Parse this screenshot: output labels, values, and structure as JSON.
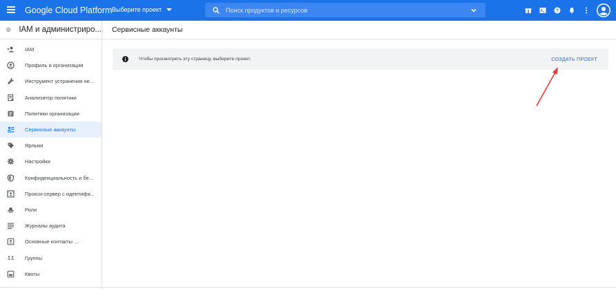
{
  "topbar": {
    "brand": "Google Cloud Platform",
    "project_select": "Выберите проект",
    "search_placeholder": "Поиск продуктов и ресурсов",
    "color": "#1a73e8",
    "icons": [
      "gift-icon",
      "terminal-icon",
      "help-icon",
      "bell-icon",
      "more-vert-icon",
      "account-icon"
    ]
  },
  "sidebar": {
    "title": "IAM и администриро...",
    "items": [
      {
        "label": "IAM",
        "icon": "person-add-icon",
        "active": false
      },
      {
        "label": "Профиль и организация",
        "icon": "account-circle-icon",
        "active": false
      },
      {
        "label": "Инструмент устранения не...",
        "icon": "wrench-icon",
        "active": false
      },
      {
        "label": "Анализатор политики",
        "icon": "policy-document-icon",
        "active": false
      },
      {
        "label": "Политики организации",
        "icon": "list-box-icon",
        "active": false
      },
      {
        "label": "Сервисные аккаунты",
        "icon": "service-account-icon",
        "active": true
      },
      {
        "label": "Ярлыки",
        "icon": "label-icon",
        "active": false
      },
      {
        "label": "Настройки",
        "icon": "gear-icon",
        "active": false
      },
      {
        "label": "Конфиденциальность и бе...",
        "icon": "shield-icon",
        "active": false
      },
      {
        "label": "Прокси-сервер с идентифи...",
        "icon": "proxy-icon",
        "active": false
      },
      {
        "label": "Роли",
        "icon": "roles-hat-icon",
        "active": false
      },
      {
        "label": "Журналы аудита",
        "icon": "audit-lines-icon",
        "active": false
      },
      {
        "label": "Основные контакты ...",
        "icon": "contacts-icon",
        "active": false
      },
      {
        "label": "Группы",
        "icon": "groups-icon",
        "active": false
      },
      {
        "label": "Квоты",
        "icon": "quota-icon",
        "active": false
      }
    ]
  },
  "main": {
    "title": "Сервисные аккаунты",
    "notice_text": "Чтобы просмотреть эту страницу, выберите проект.",
    "create_project": "СОЗДАТЬ ПРОЕКТ",
    "arrow_color": "#e53935"
  }
}
